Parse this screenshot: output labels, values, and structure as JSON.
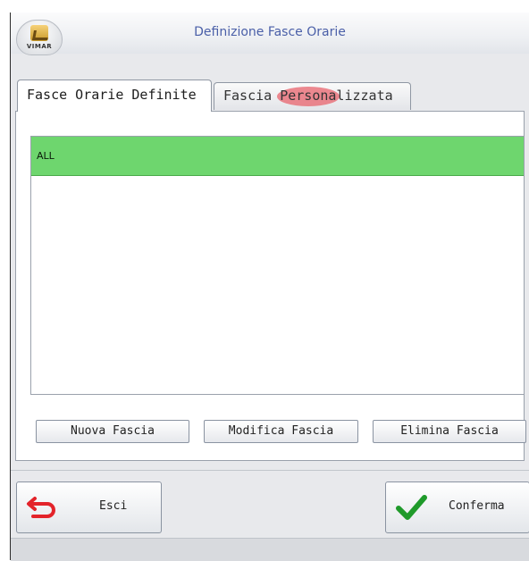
{
  "window": {
    "title": "Definizione Fasce Orarie",
    "logo_text": "VIMAR"
  },
  "tabs": [
    {
      "label": "Fasce Orarie Definite",
      "active": true
    },
    {
      "label": "Fascia Personalizzata",
      "active": false
    }
  ],
  "list": {
    "items": [
      {
        "label": "ALL",
        "selected": true
      }
    ]
  },
  "buttons": {
    "new": "Nuova Fascia",
    "edit": "Modifica Fascia",
    "delete": "Elimina Fascia",
    "exit": "Esci",
    "confirm": "Conferma"
  },
  "colors": {
    "selected_row": "#6ed66e",
    "title_text": "#4a5fa8",
    "exit_icon": "#e3232a",
    "confirm_icon": "#1f9a2a"
  },
  "icons": {
    "exit": "back-arrow-icon",
    "confirm": "checkmark-icon"
  }
}
